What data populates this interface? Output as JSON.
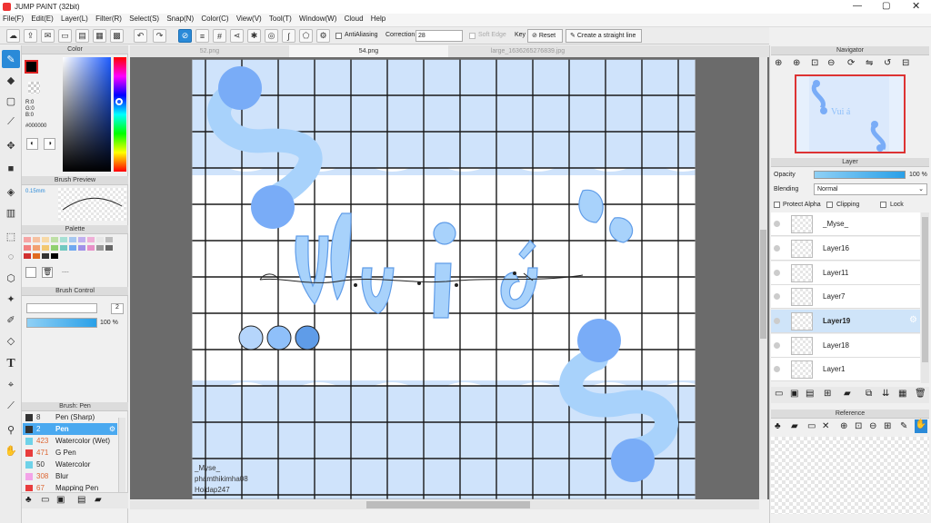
{
  "app": {
    "title": "JUMP PAINT (32bit)"
  },
  "menu": [
    "File(F)",
    "Edit(E)",
    "Layer(L)",
    "Filter(R)",
    "Select(S)",
    "Snap(N)",
    "Color(C)",
    "View(V)",
    "Tool(T)",
    "Window(W)",
    "Cloud",
    "Help"
  ],
  "toolbar": {
    "antialiasing": "AntiAliasing",
    "correction_label": "Correction",
    "correction_value": "28",
    "soft_edge": "Soft Edge",
    "key": "Key",
    "reset": "Reset",
    "straight_line": "Create a straight line"
  },
  "tabs": [
    "52.png",
    "54.png",
    "large_1636265276839.jpg"
  ],
  "color_panel": {
    "title": "Color",
    "r": "R:0",
    "g": "G:0",
    "b": "B:0",
    "hex": "#000000"
  },
  "brush_preview": {
    "title": "Brush Preview",
    "size": "0.15mm"
  },
  "palette": {
    "title": "Palette",
    "more": "....",
    "colors": [
      "#f6a5a5",
      "#f6c1a0",
      "#f7d9a6",
      "#bfe0a6",
      "#a6e0d4",
      "#a6c8f0",
      "#c1b0f0",
      "#f0b0d8",
      "#e7e7e7",
      "#bdbdbd",
      "#f28080",
      "#f2a070",
      "#f2c870",
      "#90d070",
      "#70c8c0",
      "#70a8f0",
      "#a090e8",
      "#e890c8",
      "#999999",
      "#666666",
      "#d03030",
      "#e06a20",
      "#333333",
      "#000000"
    ]
  },
  "brush_control": {
    "title": "Brush Control",
    "size_value": "2",
    "opacity_value": "100 %"
  },
  "brush_list": {
    "title": "Brush: Pen",
    "items": [
      {
        "size": "8",
        "name": "Pen (Sharp)",
        "color": "#333333"
      },
      {
        "size": "2",
        "name": "Pen",
        "color": "#333333"
      },
      {
        "size": "423",
        "name": "Watercolor (Wet)",
        "color": "#6fd2e8"
      },
      {
        "size": "471",
        "name": "G Pen",
        "color": "#e83d3d"
      },
      {
        "size": "50",
        "name": "Watercolor",
        "color": "#6fd2e8"
      },
      {
        "size": "308",
        "name": "Blur",
        "color": "#f3a3e8"
      },
      {
        "size": "67",
        "name": "Mapping Pen",
        "color": "#e83d3d"
      }
    ]
  },
  "navigator": {
    "title": "Navigator"
  },
  "layer_panel": {
    "title": "Layer",
    "opacity_label": "Opacity",
    "opacity_value": "100 %",
    "blending_label": "Blending",
    "blending_value": "Normal",
    "protect_alpha": "Protect Alpha",
    "clipping": "Clipping",
    "lock": "Lock",
    "layers": [
      "_Myse_",
      "Layer16",
      "Layer11",
      "Layer7",
      "Layer19",
      "Layer18",
      "Layer1"
    ]
  },
  "reference": {
    "title": "Reference"
  },
  "canvas_text": {
    "line1": "_Myse_",
    "line2": "phamthikimha08",
    "line3": "Hoidap247"
  }
}
